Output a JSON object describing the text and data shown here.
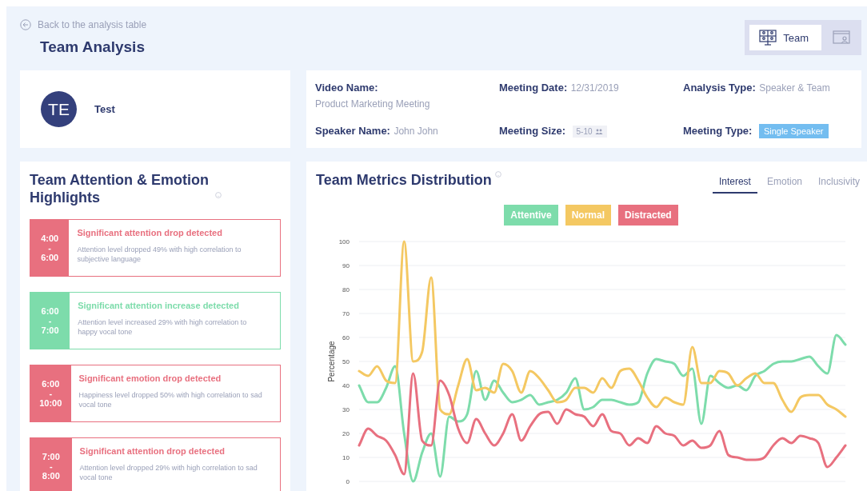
{
  "back_link": {
    "label": "Back to the analysis table"
  },
  "title": "Team Analysis",
  "view_toggle": [
    {
      "kind": "team",
      "label": "Team",
      "selected": true
    },
    {
      "kind": "presentation",
      "selected": false
    }
  ],
  "profile": {
    "initials": "TE",
    "name": "Test"
  },
  "meeting_info": [
    {
      "label": "Video Name:",
      "value": "Product Marketing Meeting",
      "kind": "stacked"
    },
    {
      "label": "Meeting Date:",
      "value": "12/31/2019",
      "kind": "inline"
    },
    {
      "label": "Analysis Type:",
      "value": "Speaker & Team",
      "kind": "inline"
    },
    {
      "label": "Speaker Name:",
      "value": "John John",
      "kind": "inline"
    },
    {
      "label": "Meeting Size:",
      "value": "5-10",
      "kind": "size"
    },
    {
      "label": "Meeting Type:",
      "value": "Single Speaker",
      "kind": "tag"
    }
  ],
  "highlights": {
    "title": "Team Attention & Emotion Highlights",
    "items": [
      {
        "start": "4:00",
        "dash": "-",
        "end": "6:00",
        "title": "Significant attention drop detected",
        "description": "Attention level dropped 49% with high correlation to subjective language",
        "color": "#e8707f"
      },
      {
        "start": "6:00",
        "dash": "-",
        "end": "7:00",
        "title": "Significant attention increase detected",
        "description": "Attention level increased 29% with high correlation to happy vocal tone",
        "color": "#7ddcab"
      },
      {
        "start": "6:00",
        "dash": "-",
        "end": "10:00",
        "title": "Significant emotion drop detected",
        "description": "Happiness level dropped 50% with high correlation to sad vocal tone",
        "color": "#e8707f"
      },
      {
        "start": "7:00",
        "dash": "-",
        "end": "8:00",
        "title": "Significant attention drop detected",
        "description": "Attention level dropped 29% with high correlation to sad vocal tone",
        "color": "#e8707f"
      }
    ]
  },
  "metrics": {
    "title": "Team Metrics Distribution",
    "tabs": [
      {
        "label": "Interest",
        "selected": true
      },
      {
        "label": "Emotion",
        "selected": false
      },
      {
        "label": "Inclusivity",
        "selected": false
      }
    ],
    "chart_data": {
      "type": "line",
      "ylabel": "Percentage",
      "ylim": [
        0,
        100
      ],
      "yticks": [
        0,
        10,
        20,
        30,
        40,
        50,
        60,
        70,
        80,
        90,
        100
      ],
      "grid": true,
      "series": [
        {
          "name": "Attentive",
          "color": "#7ddcab",
          "values": [
            40,
            33,
            33,
            39,
            48,
            20,
            0,
            12,
            20,
            2,
            27,
            25,
            28,
            46,
            34,
            42,
            37,
            33,
            34,
            36,
            32,
            33,
            34,
            37,
            43,
            30,
            31,
            34,
            34,
            33,
            32,
            33,
            45,
            51,
            50,
            49,
            44,
            47,
            24,
            44,
            41,
            39,
            40,
            38,
            44,
            46,
            49,
            50,
            50,
            51,
            52,
            48,
            45,
            61,
            57
          ]
        },
        {
          "name": "Normal",
          "color": "#f4c862",
          "values": [
            46,
            44,
            48,
            42,
            41,
            100,
            50,
            54,
            85,
            30,
            28,
            40,
            51,
            38,
            39,
            37,
            49,
            46,
            37,
            46,
            43,
            38,
            33,
            34,
            39,
            39,
            37,
            43,
            39,
            46,
            47,
            42,
            35,
            31,
            35,
            33,
            32,
            56,
            41,
            41,
            46,
            45,
            40,
            43,
            45,
            41,
            41,
            34,
            29,
            35,
            36,
            36,
            32,
            30,
            27
          ]
        },
        {
          "name": "Distracted",
          "color": "#e8707f",
          "values": [
            15,
            22,
            19,
            17,
            11,
            3,
            45,
            17,
            15,
            42,
            36,
            22,
            16,
            26,
            20,
            15,
            20,
            28,
            17,
            23,
            28,
            29,
            24,
            30,
            28,
            27,
            23,
            28,
            21,
            20,
            15,
            18,
            16,
            23,
            20,
            19,
            15,
            17,
            14,
            15,
            21,
            11,
            10,
            9,
            9,
            10,
            15,
            18,
            16,
            19,
            18,
            16,
            6,
            10,
            15
          ]
        }
      ]
    }
  }
}
